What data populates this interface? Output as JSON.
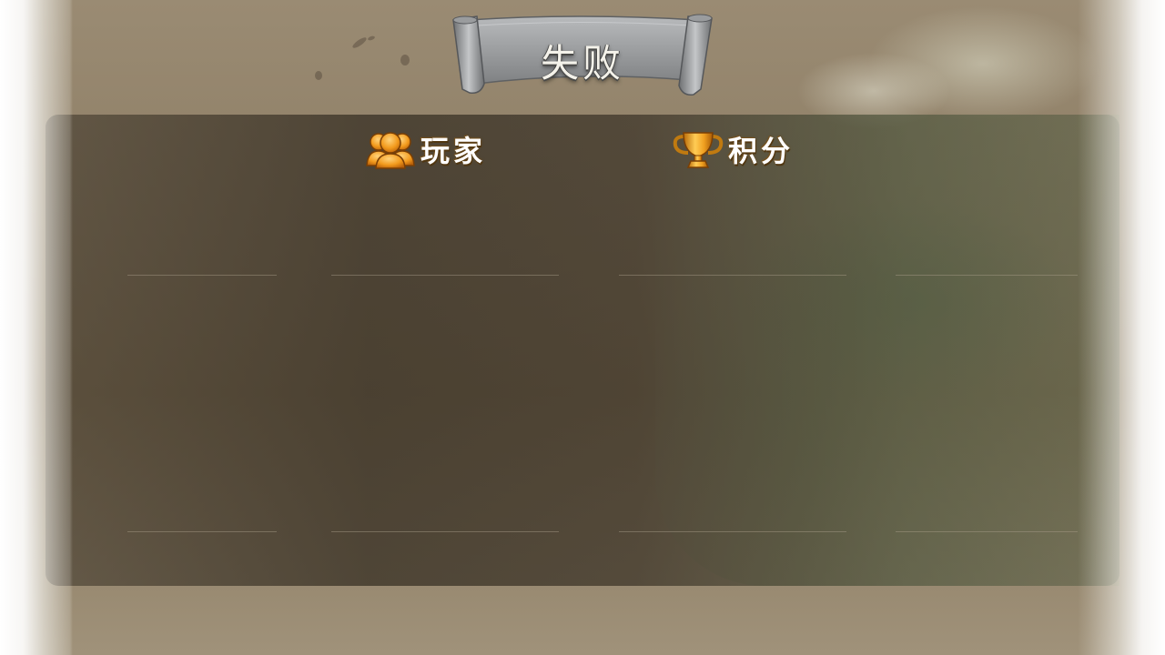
{
  "result": {
    "title": "失败"
  },
  "columns": [
    {
      "label": "玩家",
      "icon": "players-icon"
    },
    {
      "label": "积分",
      "icon": "trophy-icon"
    }
  ],
  "colors": {
    "panel": "#3a3226",
    "scroll": "#9a9c9e",
    "icon_gold": "#f0a020",
    "header_text": "#ffffff"
  }
}
